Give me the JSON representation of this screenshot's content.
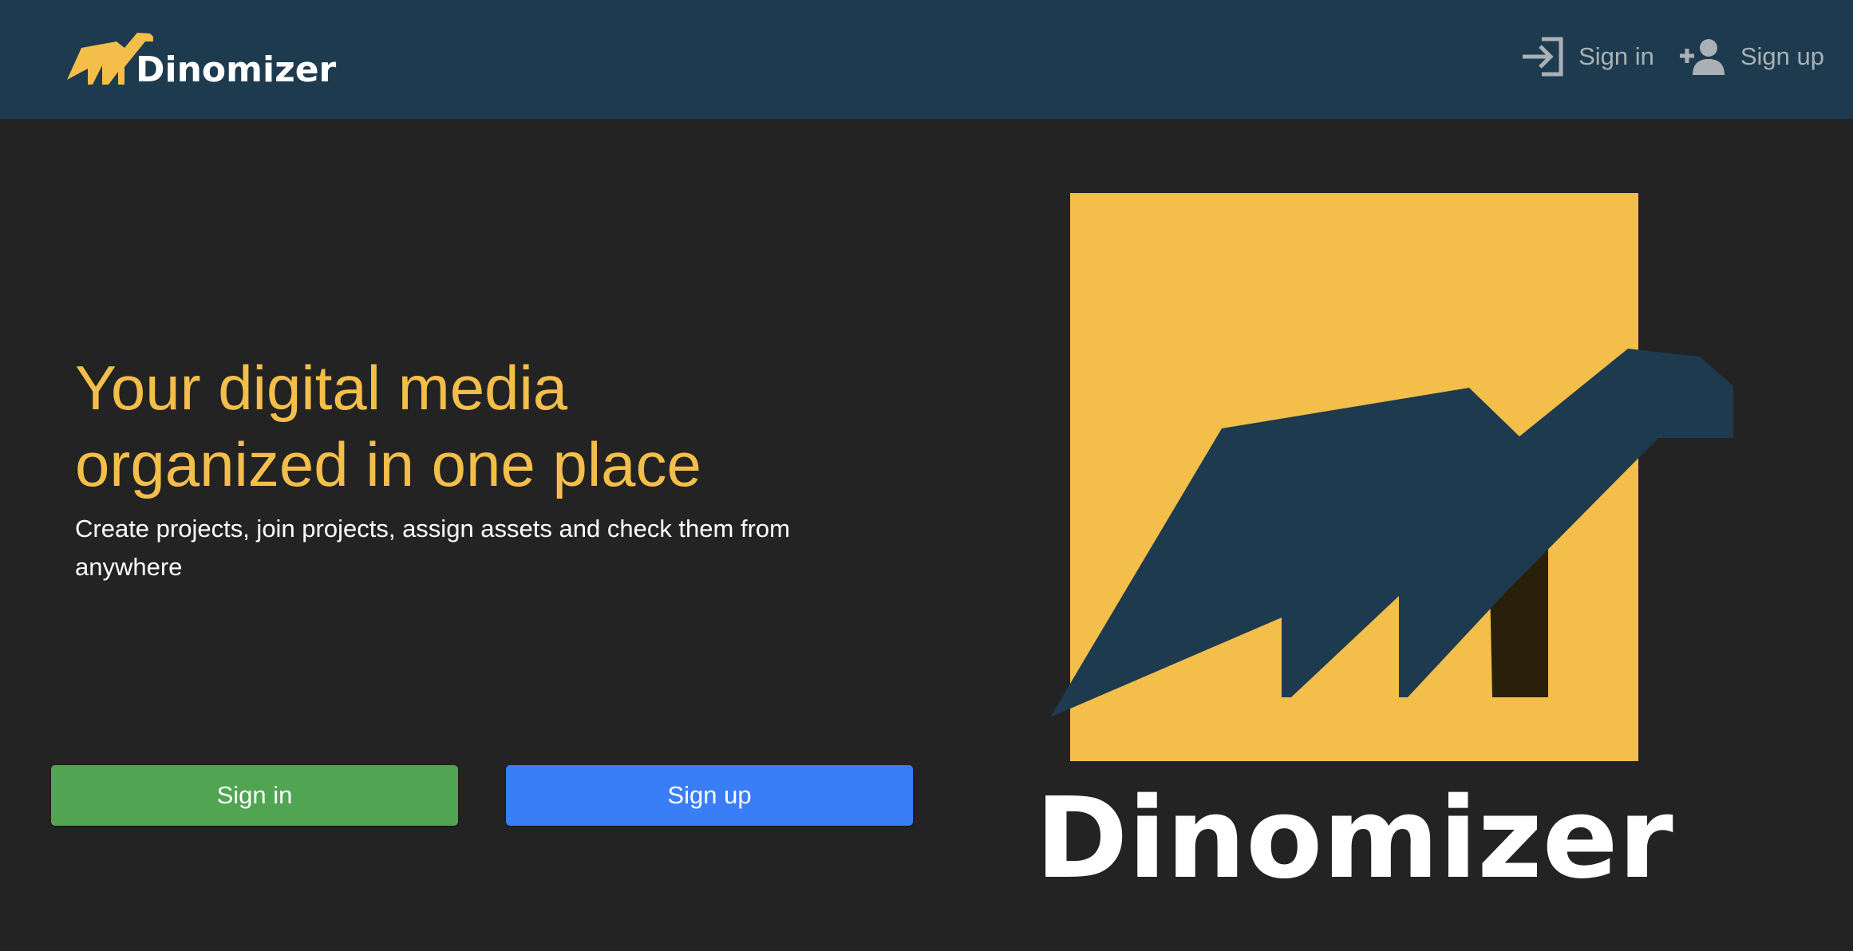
{
  "app": {
    "brand_name": "Dinomizer"
  },
  "nav": {
    "signin_label": "Sign in",
    "signup_label": "Sign up"
  },
  "hero": {
    "headline_line1": "Your digital media",
    "headline_line2": "organized in one place",
    "subtitle": "Create projects, join projects, assign assets and check them from anywhere",
    "logo_text": "Dinomizer"
  },
  "actions": {
    "signin_label": "Sign in",
    "signup_label": "Sign up"
  },
  "icons": {
    "nav_signin": "login-icon",
    "nav_signup": "add-user-icon"
  },
  "colors": {
    "navbar_bg": "#1d3a4f",
    "page_bg": "#232323",
    "accent_yellow": "#f4be4a",
    "signin_green": "#51a552",
    "signup_blue": "#3a7ef5",
    "nav_link": "#a9b1b6"
  }
}
